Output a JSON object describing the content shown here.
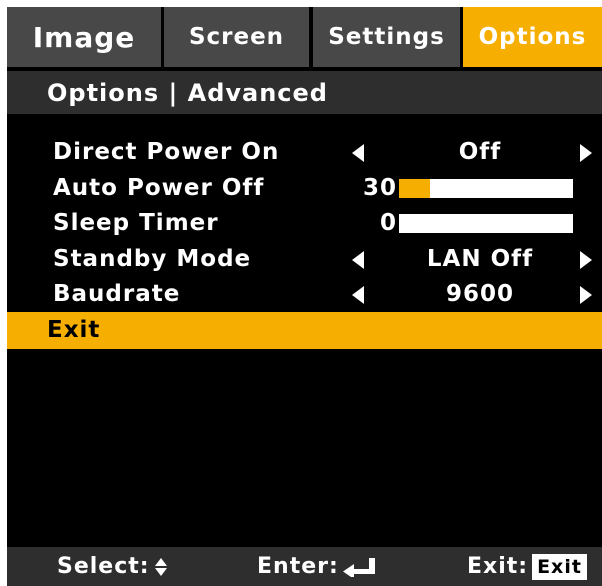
{
  "tabs": [
    {
      "label": "Image",
      "active": false
    },
    {
      "label": "Screen",
      "active": false
    },
    {
      "label": "Settings",
      "active": false
    },
    {
      "label": "Options",
      "active": true
    }
  ],
  "breadcrumb": "Options | Advanced",
  "rows": {
    "direct_power_on": {
      "label": "Direct Power On",
      "value": "Off"
    },
    "auto_power_off": {
      "label": "Auto Power Off",
      "value": "30",
      "bar_fraction": 0.18
    },
    "sleep_timer": {
      "label": "Sleep Timer",
      "value": "0",
      "bar_fraction": 0.0
    },
    "standby_mode": {
      "label": "Standby Mode",
      "value": "LAN Off"
    },
    "baudrate": {
      "label": "Baudrate",
      "value": "9600"
    }
  },
  "exit": {
    "label": "Exit"
  },
  "footer": {
    "select_label": "Select:",
    "enter_label": "Enter:",
    "exit_label": "Exit:",
    "exit_key": "Exit",
    "select_icon": "up-down-triangle-icon",
    "enter_icon": "return-arrow-icon"
  },
  "colors": {
    "accent": "#f6ae00",
    "tab_inactive": "#484848",
    "bar_background": "#2e2e2e",
    "background": "#000000",
    "text": "#ffffff"
  }
}
